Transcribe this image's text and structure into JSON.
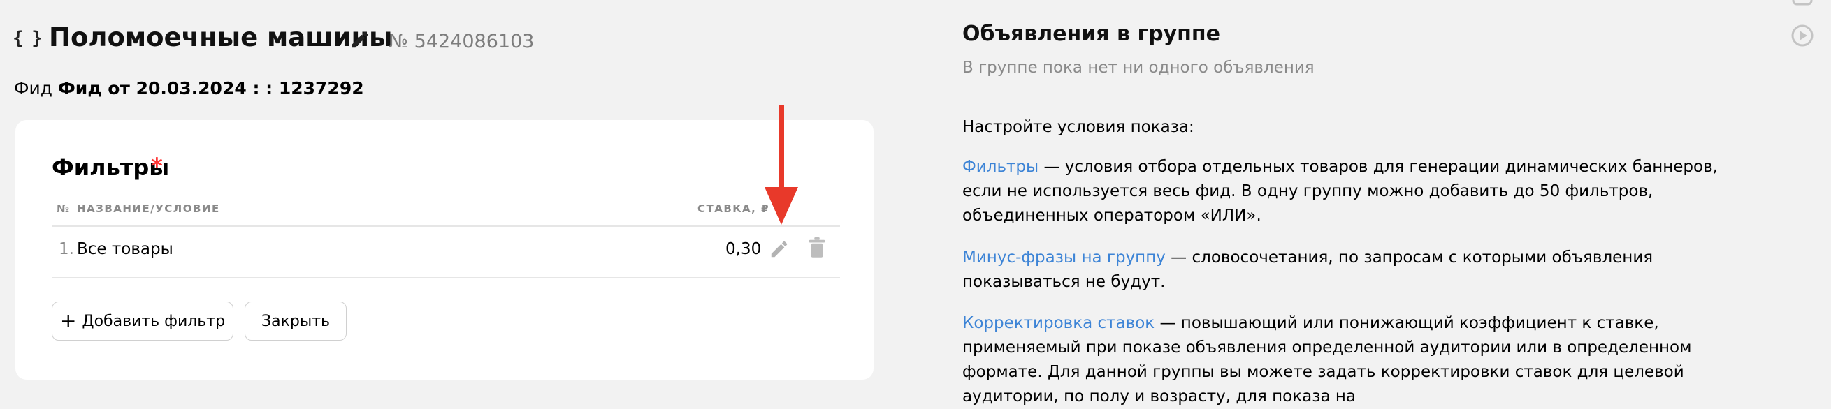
{
  "group": {
    "title": "Поломоечные машины",
    "number": "№ 5424086103",
    "feed_prefix": "Фид",
    "feed_name": "Фид от 20.03.2024 : : 1237292"
  },
  "filters": {
    "title": "Фильтры",
    "required_mark": "*",
    "columns": {
      "no": "№",
      "name": "НАЗВАНИЕ/УСЛОВИЕ",
      "rate": "СТАВКА, ₽"
    },
    "rows": [
      {
        "index": "1.",
        "name": "Все товары",
        "rate": "0,30"
      }
    ],
    "add_button": "Добавить фильтр",
    "close_button": "Закрыть"
  },
  "panel": {
    "title": "Объявления в группе",
    "subtitle": "В группе пока нет ни одного объявления",
    "setup": "Настройте условия показа:",
    "items": [
      {
        "link": "Фильтры",
        "text": " — условия отбора отдельных товаров для генерации динамических баннеров, если не используется весь фид. В одну группу можно добавить до 50 фильтров, объединенных оператором «ИЛИ»."
      },
      {
        "link": "Минус-фразы на группу",
        "text": " — словосочетания, по запросам с которыми объявления показываться не будут."
      },
      {
        "link": "Корректировка ставок",
        "text": " — повышающий или понижающий коэффициент к ставке, применяемый при показе объявления определенной аудитории или в определенном формате. Для данной группы вы можете задать корректировки ставок для целевой аудитории, по полу и возрасту, для показа на"
      }
    ]
  },
  "colors": {
    "link": "#3d84d6",
    "required": "#ff3333",
    "arrow": "#e8392a",
    "muted": "#8a8a8a"
  },
  "icons": [
    "braces-icon",
    "pencil-icon",
    "trash-icon",
    "plus-icon",
    "play-icon"
  ]
}
